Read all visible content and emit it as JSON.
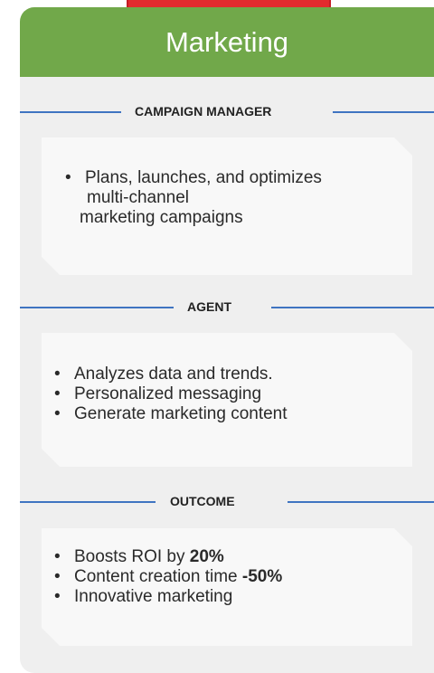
{
  "header": {
    "title": "Marketing"
  },
  "sections": [
    {
      "title": "CAMPAIGN MANAGER",
      "bullet": "Plans, launches, and optimizes multi-channel marketing campaigns",
      "bullet_lines": [
        "Plans, launches, and optimizes",
        "multi-channel",
        "marketing campaigns"
      ]
    },
    {
      "title": "AGENT",
      "bullets": [
        "Analyzes data and trends.",
        "Personalized messaging",
        "Generate marketing content"
      ]
    },
    {
      "title": "OUTCOME",
      "bullets": [
        {
          "text": "Boosts ROI by ",
          "bold": "20%"
        },
        {
          "text": "Content creation time ",
          "bold": "-50%"
        },
        {
          "text": "Innovative marketing",
          "bold": ""
        }
      ]
    }
  ],
  "colors": {
    "header_green": "#71a84a",
    "rule_blue": "#3f74c1",
    "top_accent_red": "#e32a2e",
    "card_bg": "#efefef",
    "panel_bg": "#f8f8f8"
  }
}
